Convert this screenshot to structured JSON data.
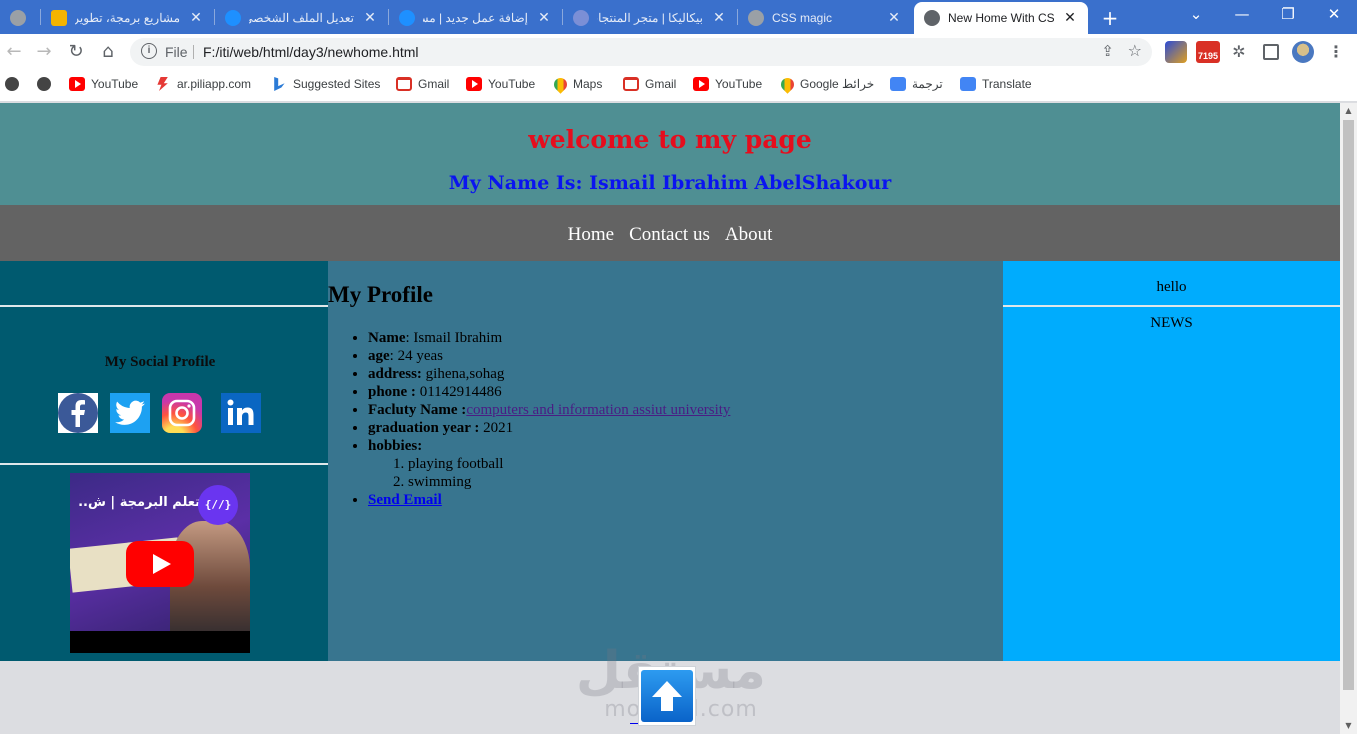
{
  "browser": {
    "tabs": [
      {
        "title": "",
        "color": "#9aa0a6"
      },
      {
        "title": "مشاريع برمجة، تطوير",
        "color": "#f4b400"
      },
      {
        "title": "تعديل الملف الشخصي",
        "color": "#1e90ff"
      },
      {
        "title": "إضافة عمل جديد | مس",
        "color": "#1e90ff"
      },
      {
        "title": "بيكاليكا | متجر المنتجات",
        "color": "#7b8fd6"
      },
      {
        "title": "CSS magic",
        "color": "#9aa0a6"
      },
      {
        "title": "New Home With CSS",
        "color": "#5f6368",
        "active": true
      }
    ],
    "new_tab": "+",
    "window_controls": {
      "list": "⌄",
      "minimize": "—",
      "maximize": "❐",
      "close": "✕"
    },
    "nav": {
      "back": "←",
      "forward": "→",
      "reload": "↻",
      "home": "⌂"
    },
    "address": {
      "info": "i",
      "scheme": "File",
      "url": "F:/iti/web/html/day3/newhome.html",
      "share": "⇪",
      "star": "☆"
    },
    "extensions": {
      "gmail_badge": "7195",
      "puzzle": "✲",
      "menu": "⋮"
    },
    "bookmarks": [
      {
        "label": "",
        "icon": "globe"
      },
      {
        "label": "",
        "icon": "globe"
      },
      {
        "label": "YouTube",
        "icon": "youtube"
      },
      {
        "label": "ar.piliapp.com",
        "icon": "piliapp"
      },
      {
        "label": "Suggested Sites",
        "icon": "bing"
      },
      {
        "label": "Gmail",
        "icon": "gmail"
      },
      {
        "label": "YouTube",
        "icon": "youtube"
      },
      {
        "label": "Maps",
        "icon": "maps"
      },
      {
        "label": "Gmail",
        "icon": "gmail"
      },
      {
        "label": "YouTube",
        "icon": "youtube"
      },
      {
        "label": "Google خرائط",
        "icon": "maps"
      },
      {
        "label": "ترجمة",
        "icon": "translate"
      },
      {
        "label": "Translate",
        "icon": "translate"
      }
    ],
    "scrollbar": {
      "up": "▲",
      "down": "▼"
    }
  },
  "page": {
    "header": {
      "title": "welcome to my page",
      "subtitle": "My Name Is: Ismail Ibrahim AbelShakour",
      "bg": "#4f8f93",
      "title_color": "#e50d1d",
      "subtitle_color": "#0a14f0"
    },
    "nav": {
      "items": [
        "Home",
        "Contact us",
        "About"
      ]
    },
    "left": {
      "social_title": "My Social Profile",
      "social_icons": [
        "facebook",
        "twitter",
        "instagram",
        "linkedin"
      ],
      "video_title": "تعلم البرمجة | ش...",
      "video_channel_badge": "{//}"
    },
    "profile": {
      "title": "My Profile",
      "name_label": "Name",
      "name_value": ": Ismail Ibrahim",
      "age_label": "age",
      "age_value": ": 24 yeas",
      "address_label": "address:",
      "address_value": " gihena,sohag",
      "phone_label": "phone :",
      "phone_value": " 01142914486",
      "faculty_label": "Facluty Name :",
      "faculty_link": "computers and information assiut university",
      "grad_label": "graduation year :",
      "grad_value": " 2021",
      "hobbies_label": "hobbies:",
      "hobbies": [
        "playing football",
        "swimming"
      ],
      "send_email": "Send Email"
    },
    "right": {
      "hello": "hello",
      "news": "NEWS"
    },
    "watermark": {
      "ar": "مستقل",
      "en": "mostaql.com"
    }
  }
}
